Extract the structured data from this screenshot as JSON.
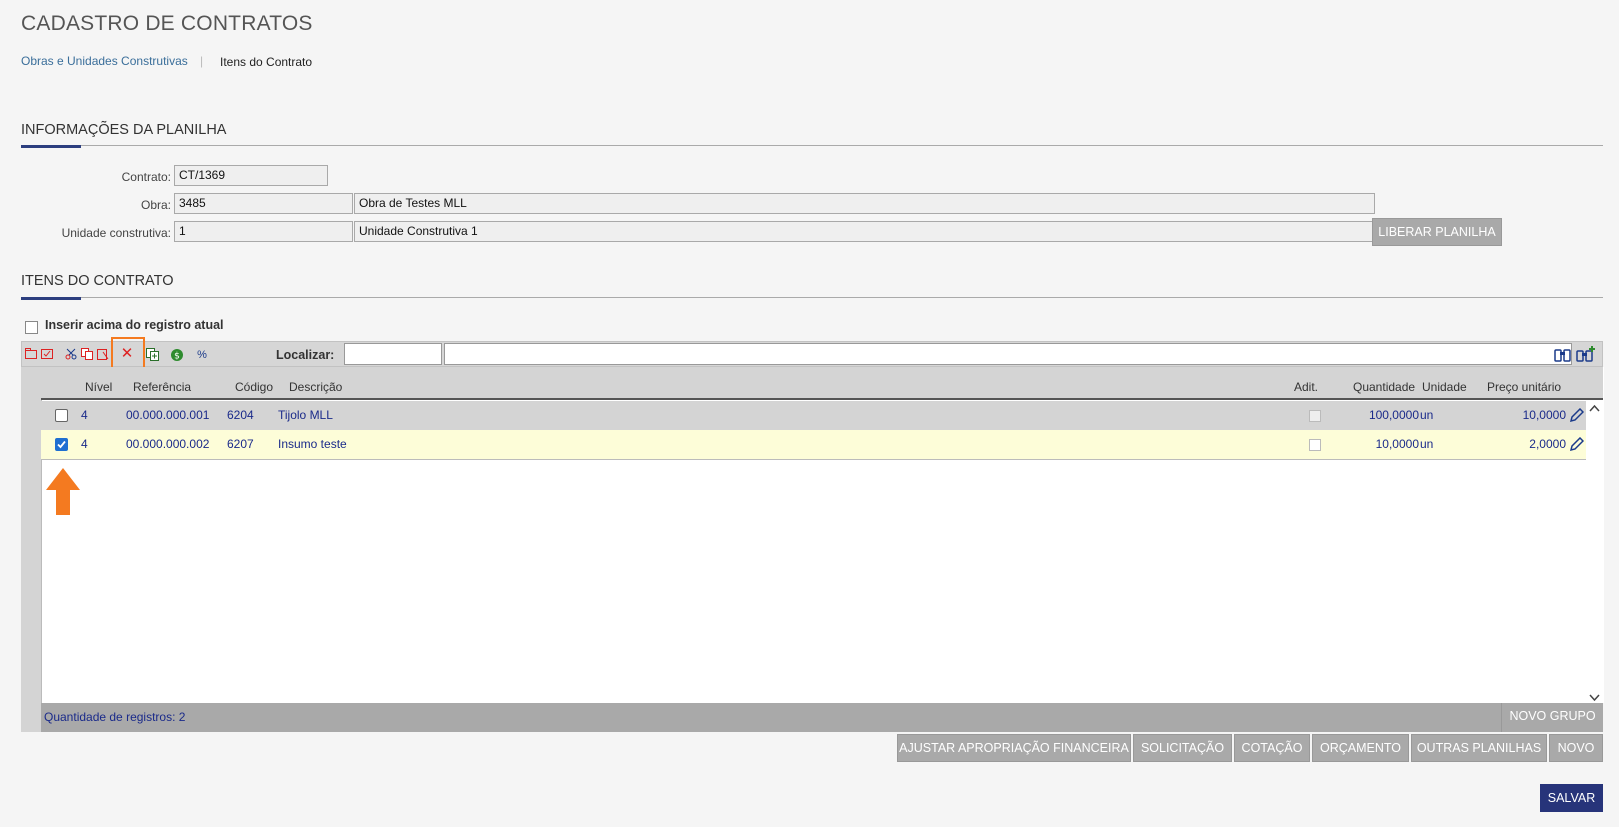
{
  "page": {
    "title": "CADASTRO DE CONTRATOS",
    "breadcrumb": {
      "link": "Obras e Unidades Construtivas",
      "separator": "|",
      "current": "Itens do Contrato"
    }
  },
  "info_section": {
    "title": "INFORMAÇÕES DA PLANILHA",
    "contrato": {
      "label": "Contrato:",
      "value": "CT/1369"
    },
    "obra": {
      "label": "Obra:",
      "code": "3485",
      "name": "Obra de Testes MLL"
    },
    "unidade": {
      "label": "Unidade construtiva:",
      "code": "1",
      "name": "Unidade Construtiva 1"
    },
    "liberar_button": "LIBERAR PLANILHA"
  },
  "items_section": {
    "title": "ITENS DO CONTRATO",
    "insert_above_label": "Inserir acima do registro atual",
    "localizar_label": "Localizar:",
    "localizar_value": "",
    "localizar_value2": "",
    "columns": {
      "nivel": "Nível",
      "referencia": "Referência",
      "codigo": "Código",
      "descricao": "Descrição",
      "adit": "Adit.",
      "quantidade": "Quantidade",
      "unidade": "Unidade",
      "preco": "Preço unitário"
    },
    "rows": [
      {
        "checked": false,
        "nivel": "4",
        "referencia": "00.000.000.001",
        "codigo": "6204",
        "descricao": "Tijolo MLL",
        "adit": false,
        "quantidade": "100,0000",
        "unidade": "un",
        "preco": "10,0000"
      },
      {
        "checked": true,
        "nivel": "4",
        "referencia": "00.000.000.002",
        "codigo": "6207",
        "descricao": "Insumo teste",
        "adit": false,
        "quantidade": "10,0000",
        "unidade": "un",
        "preco": "2,0000"
      }
    ],
    "record_count": "Quantidade de registros: 2",
    "novo_grupo": "NOVO GRUPO"
  },
  "actions": {
    "ajustar": "AJUSTAR APROPRIAÇÃO FINANCEIRA",
    "solicitacao": "SOLICITAÇÃO",
    "cotacao": "COTAÇÃO",
    "orcamento": "ORÇAMENTO",
    "outras": "OUTRAS PLANILHAS",
    "novo": "NOVO",
    "salvar": "SALVAR"
  },
  "colors": {
    "accent": "#2c3e7f",
    "highlight_row": "#fdfdd8",
    "selected_row": "#d4d4d4",
    "annotation": "#f47a20",
    "button_gray": "#a9a9a9"
  },
  "icons": [
    "add-folder-icon",
    "checklist-icon",
    "scissors-icon",
    "copy-icon",
    "paste-icon",
    "delete-x-icon",
    "duplicate-icon",
    "money-icon",
    "percent-icon",
    "binoculars-icon",
    "binoculars-plus-icon",
    "pencil-icon",
    "up-arrow-annotation",
    "scroll-up-icon",
    "scroll-down-icon"
  ]
}
